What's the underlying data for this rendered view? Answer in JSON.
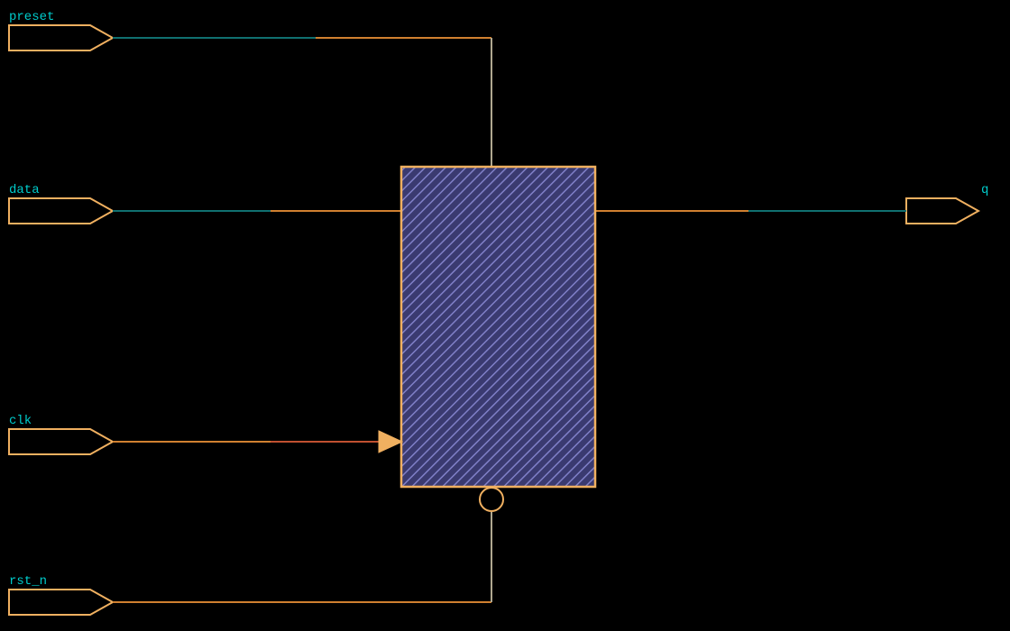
{
  "schematic": {
    "colors": {
      "background": "#000000",
      "label": "#00cccc",
      "portOutline": "#f0b060",
      "wireOrange": "#d08030",
      "wireTeal": "#107070",
      "wireGrey": "#b0a890",
      "blockFill": "#5a5aa0",
      "blockStroke": "#f0b060",
      "clkTriangle": "#f0b060",
      "bubbleStroke": "#f0b060"
    },
    "inputPorts": [
      {
        "name": "preset",
        "label": "preset"
      },
      {
        "name": "data",
        "label": "data"
      },
      {
        "name": "clk",
        "label": "clk"
      },
      {
        "name": "rst_n",
        "label": "rst_n"
      }
    ],
    "outputPorts": [
      {
        "name": "q",
        "label": "q"
      }
    ],
    "block": {
      "type": "dff-async-preset-reset",
      "clockEdge": "rising",
      "resetActiveLow": true
    }
  }
}
